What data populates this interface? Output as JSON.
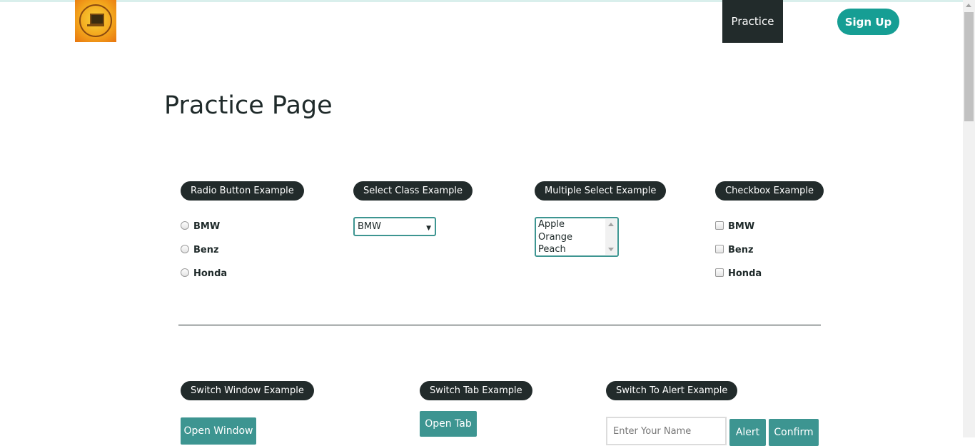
{
  "header": {
    "nav_practice": "Practice",
    "signup": "Sign Up"
  },
  "page_title": "Practice Page",
  "radio_section": {
    "legend": "Radio Button Example",
    "options": [
      "BMW",
      "Benz",
      "Honda"
    ]
  },
  "select_section": {
    "legend": "Select Class Example",
    "selected": "BMW"
  },
  "multi_section": {
    "legend": "Multiple Select Example",
    "options": [
      "Apple",
      "Orange",
      "Peach"
    ]
  },
  "checkbox_section": {
    "legend": "Checkbox Example",
    "options": [
      "BMW",
      "Benz",
      "Honda"
    ]
  },
  "window_section": {
    "legend": "Switch Window Example",
    "button": "Open Window"
  },
  "tab_section": {
    "legend": "Switch Tab Example",
    "button": "Open Tab"
  },
  "alert_section": {
    "legend": "Switch To Alert Example",
    "placeholder": "Enter Your Name",
    "alert_button": "Alert",
    "confirm_button": "Confirm"
  },
  "colors": {
    "dark": "#222b2b",
    "teal": "#3d9591",
    "signup": "#169e94"
  }
}
